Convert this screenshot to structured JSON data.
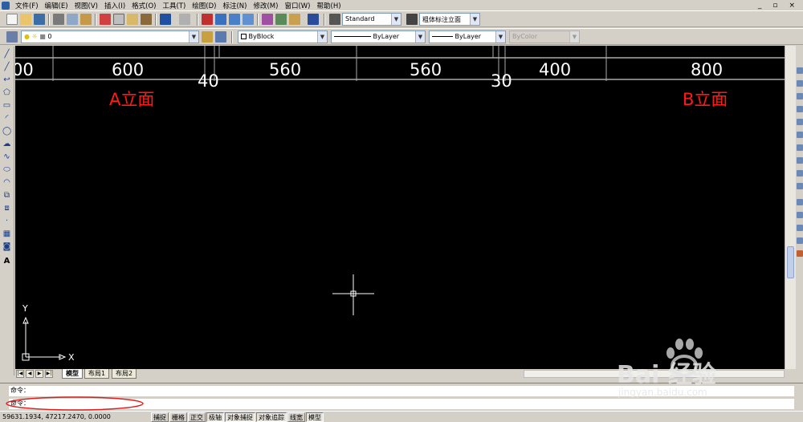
{
  "menu": [
    "文件(F)",
    "编辑(E)",
    "视图(V)",
    "插入(I)",
    "格式(O)",
    "工具(T)",
    "绘图(D)",
    "标注(N)",
    "修改(M)",
    "窗口(W)",
    "帮助(H)"
  ],
  "window_controls": [
    "_",
    "▫",
    "×"
  ],
  "toolbar": {
    "text_style": "Standard",
    "dim_style": "粗体标注立面",
    "layer": "0",
    "color": "ByBlock",
    "linetype": "ByLayer",
    "lineweight": "ByLayer",
    "plotstyle": "ByColor"
  },
  "drawing": {
    "dimensions": [
      "00",
      "600",
      "40",
      "560",
      "560",
      "30",
      "400",
      "800"
    ],
    "elevation_labels": [
      "A立面",
      "B立面"
    ],
    "ucs_x": "X",
    "ucs_y": "Y"
  },
  "tabs": [
    "模型",
    "布局1",
    "布局2"
  ],
  "command": {
    "history": "命令：",
    "prompt": "命令："
  },
  "status": {
    "coords": "59631.1934,  47217.2470,  0.0000",
    "buttons": [
      "捕捉",
      "栅格",
      "正交",
      "极轴",
      "对象捕捉",
      "对象追踪",
      "线宽",
      "模型"
    ]
  },
  "watermark": {
    "brand": "Bai 经验",
    "url": "jingyan.baidu.com"
  },
  "colors": {
    "canvas": "#000000",
    "dimension_text": "#ffffff",
    "elevation_text": "#ff1a1a",
    "highlight_ellipse": "#e02020"
  }
}
